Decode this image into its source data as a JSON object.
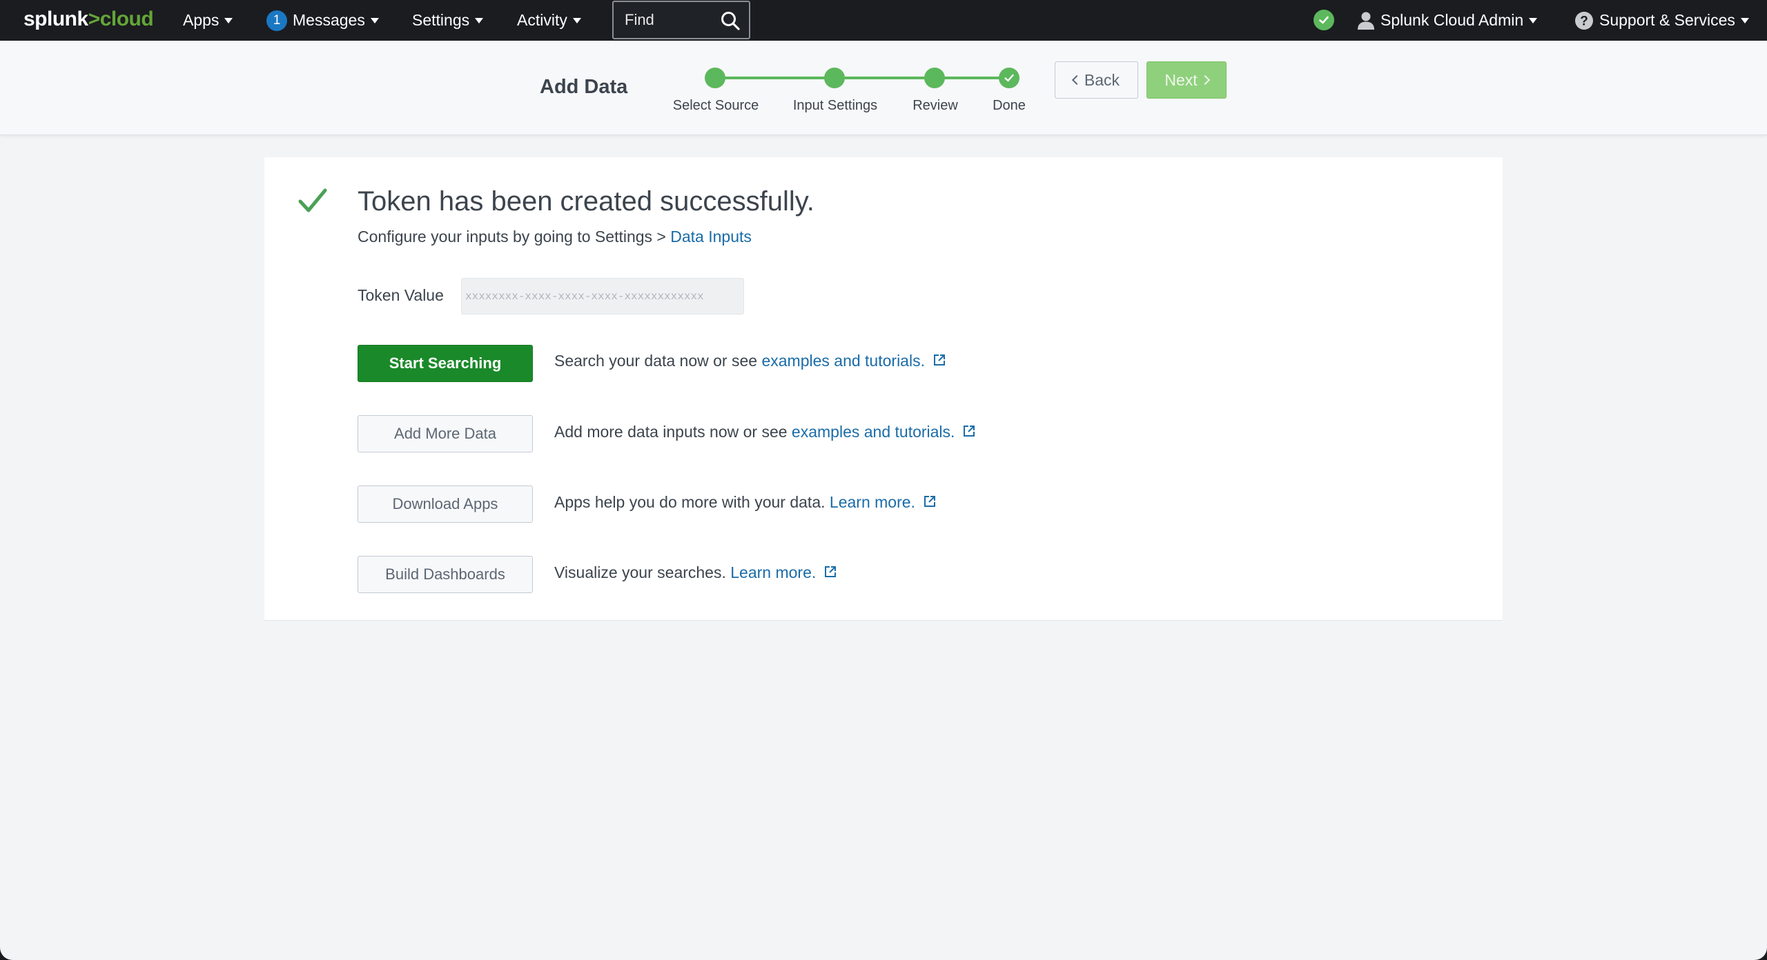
{
  "nav": {
    "logo_prefix": "splunk",
    "logo_suffix": ">cloud",
    "apps": "Apps",
    "messages_count": "1",
    "messages": "Messages",
    "settings": "Settings",
    "activity": "Activity",
    "find_placeholder": "Find",
    "user": "Splunk Cloud Admin",
    "support": "Support & Services"
  },
  "header": {
    "title": "Add Data",
    "steps": [
      "Select Source",
      "Input Settings",
      "Review",
      "Done"
    ],
    "back_label": "Back",
    "next_label": "Next"
  },
  "content": {
    "title": "Token has been created successfully.",
    "subtitle_prefix": "Configure your inputs by going to Settings > ",
    "subtitle_link": "Data Inputs",
    "token_label": "Token Value",
    "token_value": "xxxxxxxx-xxxx-xxxx-xxxx-xxxxxxxxxxxx",
    "actions": [
      {
        "button": "Start Searching",
        "text": "Search your data now or see ",
        "link": "examples and tutorials."
      },
      {
        "button": "Add More Data",
        "text": "Add more data inputs now or see ",
        "link": "examples and tutorials."
      },
      {
        "button": "Download Apps",
        "text": "Apps help you do more with your data. ",
        "link": "Learn more."
      },
      {
        "button": "Build Dashboards",
        "text": "Visualize your searches. ",
        "link": "Learn more."
      }
    ]
  },
  "colors": {
    "nav_bg": "#1a1c20",
    "accent_green": "#5cb85c",
    "primary_button": "#1a8929",
    "link": "#1a6ca8"
  },
  "icons": [
    "search-icon",
    "status-ok-icon",
    "user-icon",
    "help-icon",
    "checkmark-icon",
    "external-link-icon",
    "chevron-left-icon",
    "chevron-right-icon"
  ]
}
